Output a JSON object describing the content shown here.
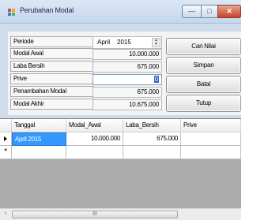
{
  "window": {
    "title": "Perubahan Modal"
  },
  "form": {
    "labels": [
      "Periode",
      "Modal Awal",
      "Laba Bersih",
      "Prive",
      "Penambahan Modal",
      "Modal Akhir"
    ],
    "periode": {
      "month": "April",
      "year": "2015"
    },
    "modal_awal": "10.000.000",
    "laba_bersih": "675.000",
    "prive": "0",
    "penambahan_modal": "675.000",
    "modal_akhir": "10.675.000"
  },
  "buttons": {
    "cari_nilai": "Cari Nilai",
    "simpan": "Simpan",
    "batal": "Batal",
    "tutup": "Tutup"
  },
  "grid": {
    "columns": [
      "Tanggal",
      "Modal_Awal",
      "Laba_Bersih",
      "Prive"
    ],
    "rows": [
      {
        "tanggal": "April 2015",
        "modal_awal": "10.000.000",
        "laba_bersih": "675.000",
        "prive": ""
      }
    ],
    "new_row_marker": "*"
  },
  "scrollbar": {
    "left_arrow": "‹",
    "thumb_grip": "III"
  }
}
